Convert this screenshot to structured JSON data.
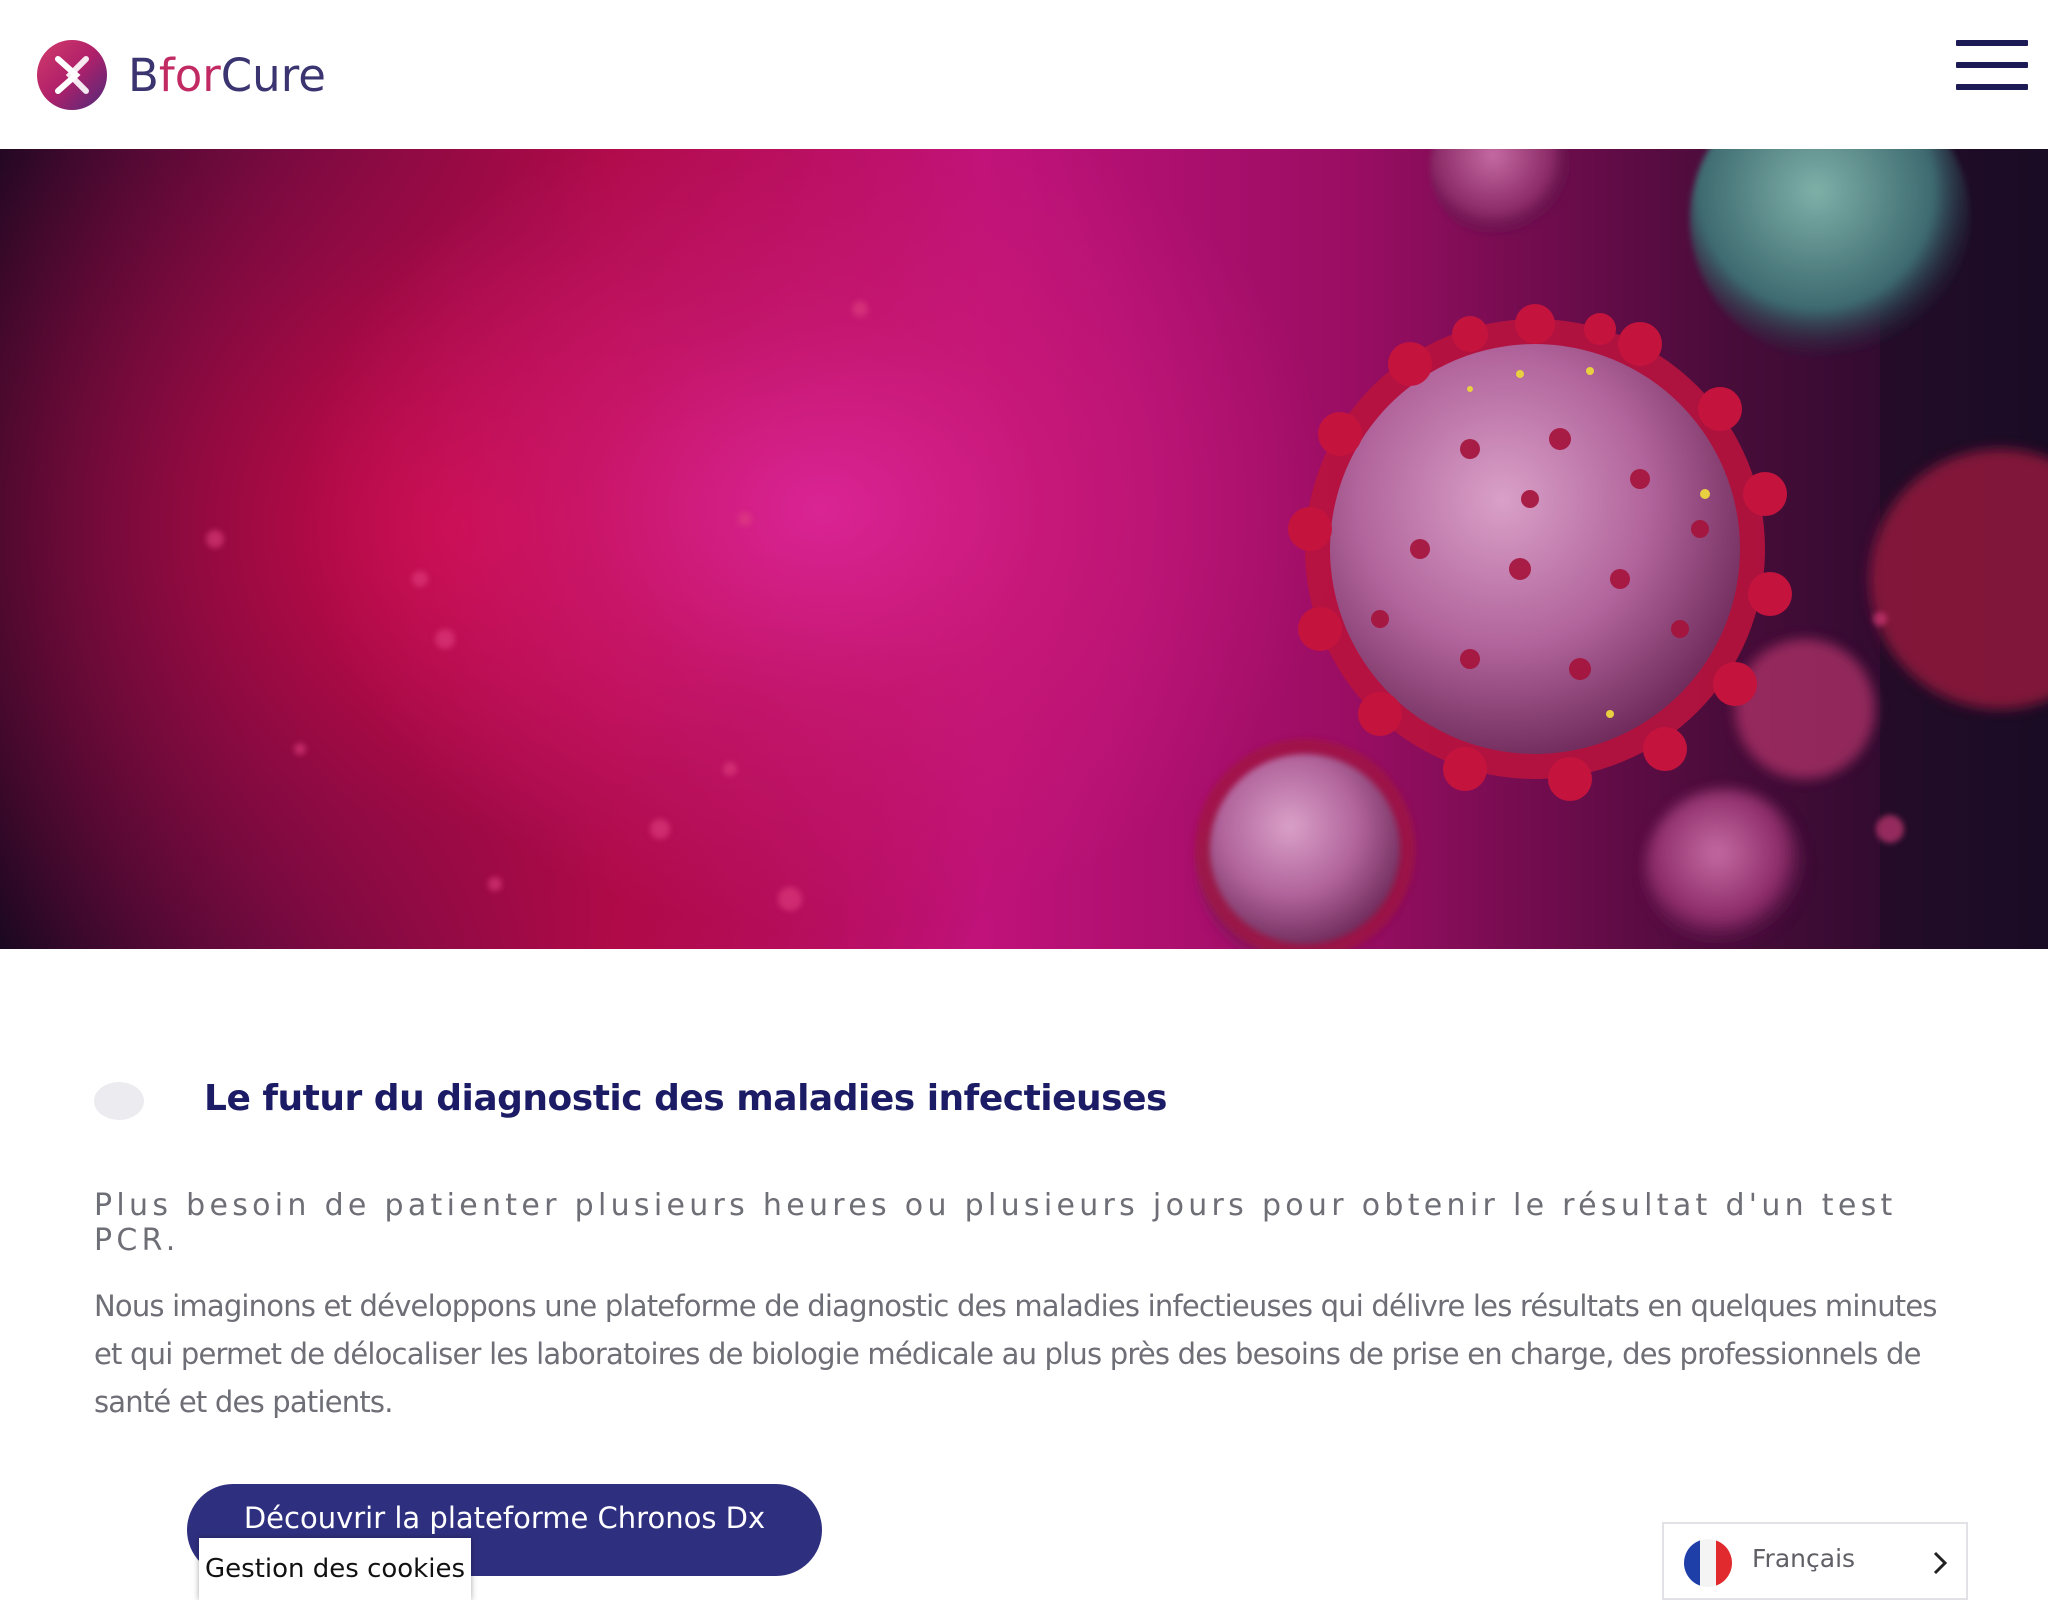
{
  "header": {
    "logo_text": {
      "part1": "B",
      "part2": "for",
      "part3": "Cure"
    },
    "menu_icon": "hamburger-icon"
  },
  "hero": {
    "image": "coronavirus-particles-illustration",
    "colors": {
      "primary": "#c0127a",
      "dark": "#12081f"
    }
  },
  "content": {
    "headline": "Le futur du diagnostic des maladies infectieuses",
    "subline": "Plus besoin de patienter plusieurs heures ou plusieurs jours pour obtenir le résultat d'un test PCR.",
    "body_lines": [
      "Nous imaginons et développons une plateforme de diagnostic des maladies infectieuses qui délivre les résultats en quelques minutes",
      "et qui permet de délocaliser les laboratoires de biologie médicale au plus près des besoins de prise en charge, des professionnels de",
      "santé et des patients."
    ],
    "cta_label": "Découvrir la plateforme Chronos Dx"
  },
  "cookies": {
    "label": "Gestion des cookies"
  },
  "language": {
    "label": "Français",
    "flag": "france-flag-icon",
    "chevron": "chevron-right-icon"
  },
  "colors": {
    "brand_navy": "#1c1b66",
    "button": "#2f2f80",
    "brand_magenta": "#c22a63",
    "text_grey": "#6e6e76"
  }
}
